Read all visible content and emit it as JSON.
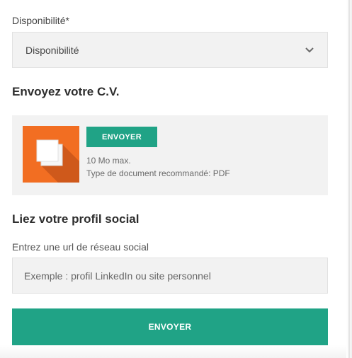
{
  "availability": {
    "label": "Disponibilité*",
    "selected": "Disponibilité"
  },
  "cv_section": {
    "title": "Envoyez votre C.V.",
    "upload_button": "ENVOYER",
    "max_size": "10 Mo max.",
    "recommended_type": "Type de document recommandé: PDF",
    "icon": "copy-document-icon"
  },
  "social_section": {
    "title": "Liez votre profil social",
    "input_label": "Entrez une url de réseau social",
    "placeholder": "Exemple : profil LinkedIn ou site personnel"
  },
  "submit_button": "ENVOYER",
  "colors": {
    "accent": "#20a386",
    "icon_orange": "#f26e22",
    "field_bg": "#f2f2f2"
  }
}
